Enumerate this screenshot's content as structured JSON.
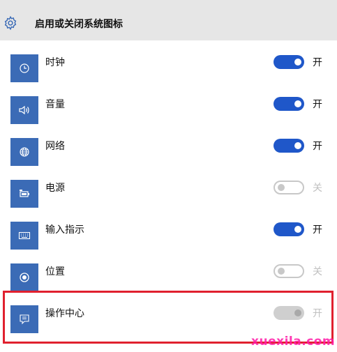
{
  "header": {
    "title": "启用或关闭系统图标",
    "icon": "gear-icon"
  },
  "items": [
    {
      "label": "时钟",
      "icon": "clock-icon",
      "toggle": "on",
      "state_text": "开"
    },
    {
      "label": "音量",
      "icon": "volume-icon",
      "toggle": "on",
      "state_text": "开"
    },
    {
      "label": "网络",
      "icon": "network-globe-icon",
      "toggle": "on",
      "state_text": "开"
    },
    {
      "label": "电源",
      "icon": "battery-power-icon",
      "toggle": "off",
      "state_text": "关"
    },
    {
      "label": "输入指示",
      "icon": "keyboard-icon",
      "toggle": "on",
      "state_text": "开"
    },
    {
      "label": "位置",
      "icon": "location-icon",
      "toggle": "off",
      "state_text": "关"
    },
    {
      "label": "操作中心",
      "icon": "action-center-icon",
      "toggle": "on-disabled",
      "state_text": "开"
    }
  ],
  "colors": {
    "header_bg": "#e6e6e6",
    "tile_bg": "#3b6bb6",
    "toggle_on": "#1f57c9",
    "highlight_box": "#e0202e",
    "watermark": "#ff1aa8"
  },
  "watermark": "xuexila.com"
}
